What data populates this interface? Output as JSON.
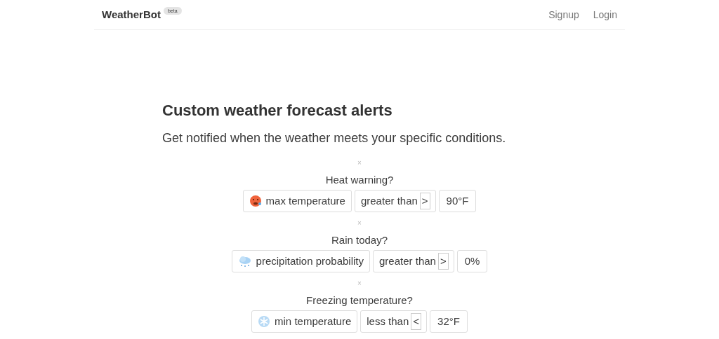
{
  "nav": {
    "brand": "WeatherBot",
    "badge": "beta",
    "links": [
      "Signup",
      "Login"
    ]
  },
  "hero": {
    "title": "Custom weather forecast alerts",
    "subtitle": "Get notified when the weather meets your specific conditions."
  },
  "alerts": [
    {
      "remove": "×",
      "question": "Heat warning?",
      "kind": "hot",
      "metric": "max temperature",
      "comparison": "greater than",
      "operator": ">",
      "value": "90°F"
    },
    {
      "remove": "×",
      "question": "Rain today?",
      "kind": "rain",
      "metric": "precipitation probability",
      "comparison": "greater than",
      "operator": ">",
      "value": "0%"
    },
    {
      "remove": "×",
      "question": "Freezing temperature?",
      "kind": "snow",
      "metric": "min temperature",
      "comparison": "less than",
      "operator": "<",
      "value": "32°F"
    }
  ]
}
